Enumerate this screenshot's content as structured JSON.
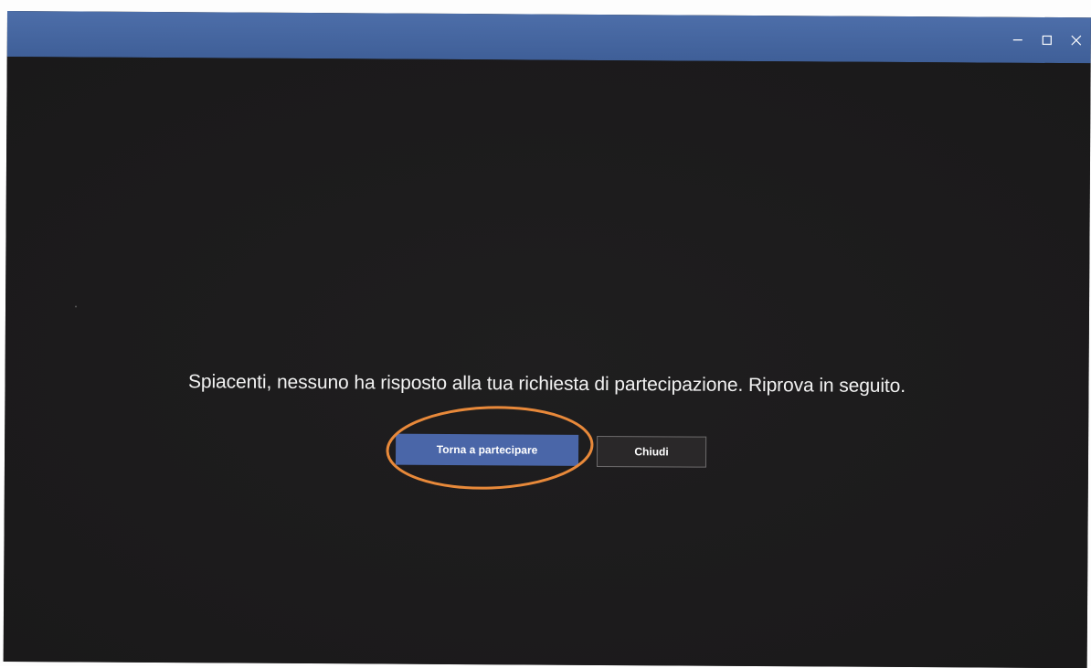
{
  "window": {
    "controls": {
      "minimize_icon": "minimize-icon",
      "maximize_icon": "maximize-icon",
      "close_icon": "close-icon"
    }
  },
  "dialog": {
    "message": "Spiacenti, nessuno ha risposto alla tua richiesta di partecipazione. Riprova in seguito.",
    "primary_button_label": "Torna a partecipare",
    "secondary_button_label": "Chiudi"
  },
  "colors": {
    "titlebar": "#4d6ea9",
    "background": "#1c1b1c",
    "primary_button": "#4a66a8",
    "annotation": "#e8893a"
  }
}
